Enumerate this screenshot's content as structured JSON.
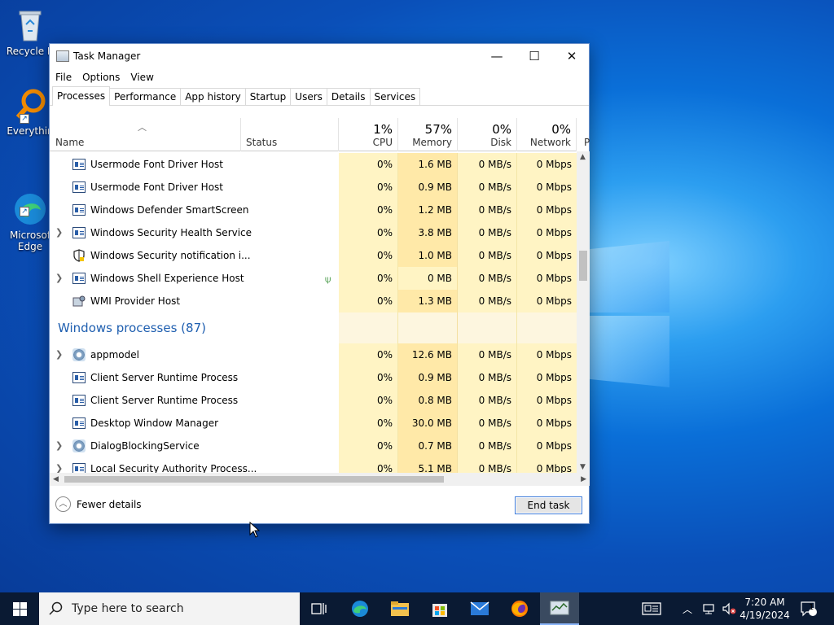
{
  "desktop": {
    "icons": [
      {
        "label": "Recycle B",
        "icon": "recycle-bin-icon"
      },
      {
        "label": "Everythin",
        "icon": "everything-search-icon"
      },
      {
        "label": "Microsof\nEdge",
        "icon": "edge-icon"
      }
    ]
  },
  "window": {
    "title": "Task Manager",
    "controls": {
      "minimize": "—",
      "maximize": "☐",
      "close": "✕"
    },
    "menu": [
      "File",
      "Options",
      "View"
    ],
    "tabs": [
      "Processes",
      "Performance",
      "App history",
      "Startup",
      "Users",
      "Details",
      "Services"
    ],
    "active_tab": "Processes"
  },
  "columns": {
    "name": "Name",
    "status": "Status",
    "cpu": {
      "pct": "1%",
      "label": "CPU"
    },
    "memory": {
      "pct": "57%",
      "label": "Memory"
    },
    "disk": {
      "pct": "0%",
      "label": "Disk"
    },
    "network": {
      "pct": "0%",
      "label": "Network"
    },
    "overflow": "P"
  },
  "rows_top": [
    {
      "name": "Usermode Font Driver Host",
      "icon": "process-window-icon",
      "expand": false,
      "cpu": "0%",
      "mem": "1.6 MB",
      "disk": "0 MB/s",
      "net": "0 Mbps",
      "leaf": false
    },
    {
      "name": "Usermode Font Driver Host",
      "icon": "process-window-icon",
      "expand": false,
      "cpu": "0%",
      "mem": "0.9 MB",
      "disk": "0 MB/s",
      "net": "0 Mbps",
      "leaf": false
    },
    {
      "name": "Windows Defender SmartScreen",
      "icon": "process-window-icon",
      "expand": false,
      "cpu": "0%",
      "mem": "1.2 MB",
      "disk": "0 MB/s",
      "net": "0 Mbps",
      "leaf": false
    },
    {
      "name": "Windows Security Health Service",
      "icon": "process-window-icon",
      "expand": true,
      "cpu": "0%",
      "mem": "3.8 MB",
      "disk": "0 MB/s",
      "net": "0 Mbps",
      "leaf": false
    },
    {
      "name": "Windows Security notification i...",
      "icon": "shield-icon",
      "expand": false,
      "cpu": "0%",
      "mem": "1.0 MB",
      "disk": "0 MB/s",
      "net": "0 Mbps",
      "leaf": false
    },
    {
      "name": "Windows Shell Experience Host",
      "icon": "process-window-icon",
      "expand": true,
      "cpu": "0%",
      "mem": "0 MB",
      "disk": "0 MB/s",
      "net": "0 Mbps",
      "leaf": true
    },
    {
      "name": "WMI Provider Host",
      "icon": "wmi-icon",
      "expand": false,
      "cpu": "0%",
      "mem": "1.3 MB",
      "disk": "0 MB/s",
      "net": "0 Mbps",
      "leaf": false
    }
  ],
  "group": {
    "title": "Windows processes (87)"
  },
  "rows_bottom": [
    {
      "name": "appmodel",
      "icon": "gear-icon",
      "expand": true,
      "cpu": "0%",
      "mem": "12.6 MB",
      "disk": "0 MB/s",
      "net": "0 Mbps"
    },
    {
      "name": "Client Server Runtime Process",
      "icon": "process-window-icon",
      "expand": false,
      "cpu": "0%",
      "mem": "0.9 MB",
      "disk": "0 MB/s",
      "net": "0 Mbps"
    },
    {
      "name": "Client Server Runtime Process",
      "icon": "process-window-icon",
      "expand": false,
      "cpu": "0%",
      "mem": "0.8 MB",
      "disk": "0 MB/s",
      "net": "0 Mbps"
    },
    {
      "name": "Desktop Window Manager",
      "icon": "process-window-icon",
      "expand": false,
      "cpu": "0%",
      "mem": "30.0 MB",
      "disk": "0 MB/s",
      "net": "0 Mbps"
    },
    {
      "name": "DialogBlockingService",
      "icon": "gear-icon",
      "expand": true,
      "cpu": "0%",
      "mem": "0.7 MB",
      "disk": "0 MB/s",
      "net": "0 Mbps"
    },
    {
      "name": "Local Security Authority Process...",
      "icon": "process-window-icon",
      "expand": true,
      "cpu": "0%",
      "mem": "5.1 MB",
      "disk": "0 MB/s",
      "net": "0 Mbps"
    }
  ],
  "footer": {
    "fewer_details": "Fewer details",
    "end_task": "End task"
  },
  "taskbar": {
    "search_placeholder": "Type here to search",
    "apps": [
      "task-view-icon",
      "edge-icon",
      "file-explorer-icon",
      "store-icon",
      "mail-icon",
      "firefox-icon",
      "task-manager-icon"
    ],
    "clock_time": "7:20 AM",
    "clock_date": "4/19/2024",
    "notification_count": "1"
  },
  "colors": {
    "group_title": "#1f5fb0",
    "heat_light": "#fff4c4",
    "heat_mid": "#ffe9a8",
    "taskbar": "#0a1a33"
  }
}
